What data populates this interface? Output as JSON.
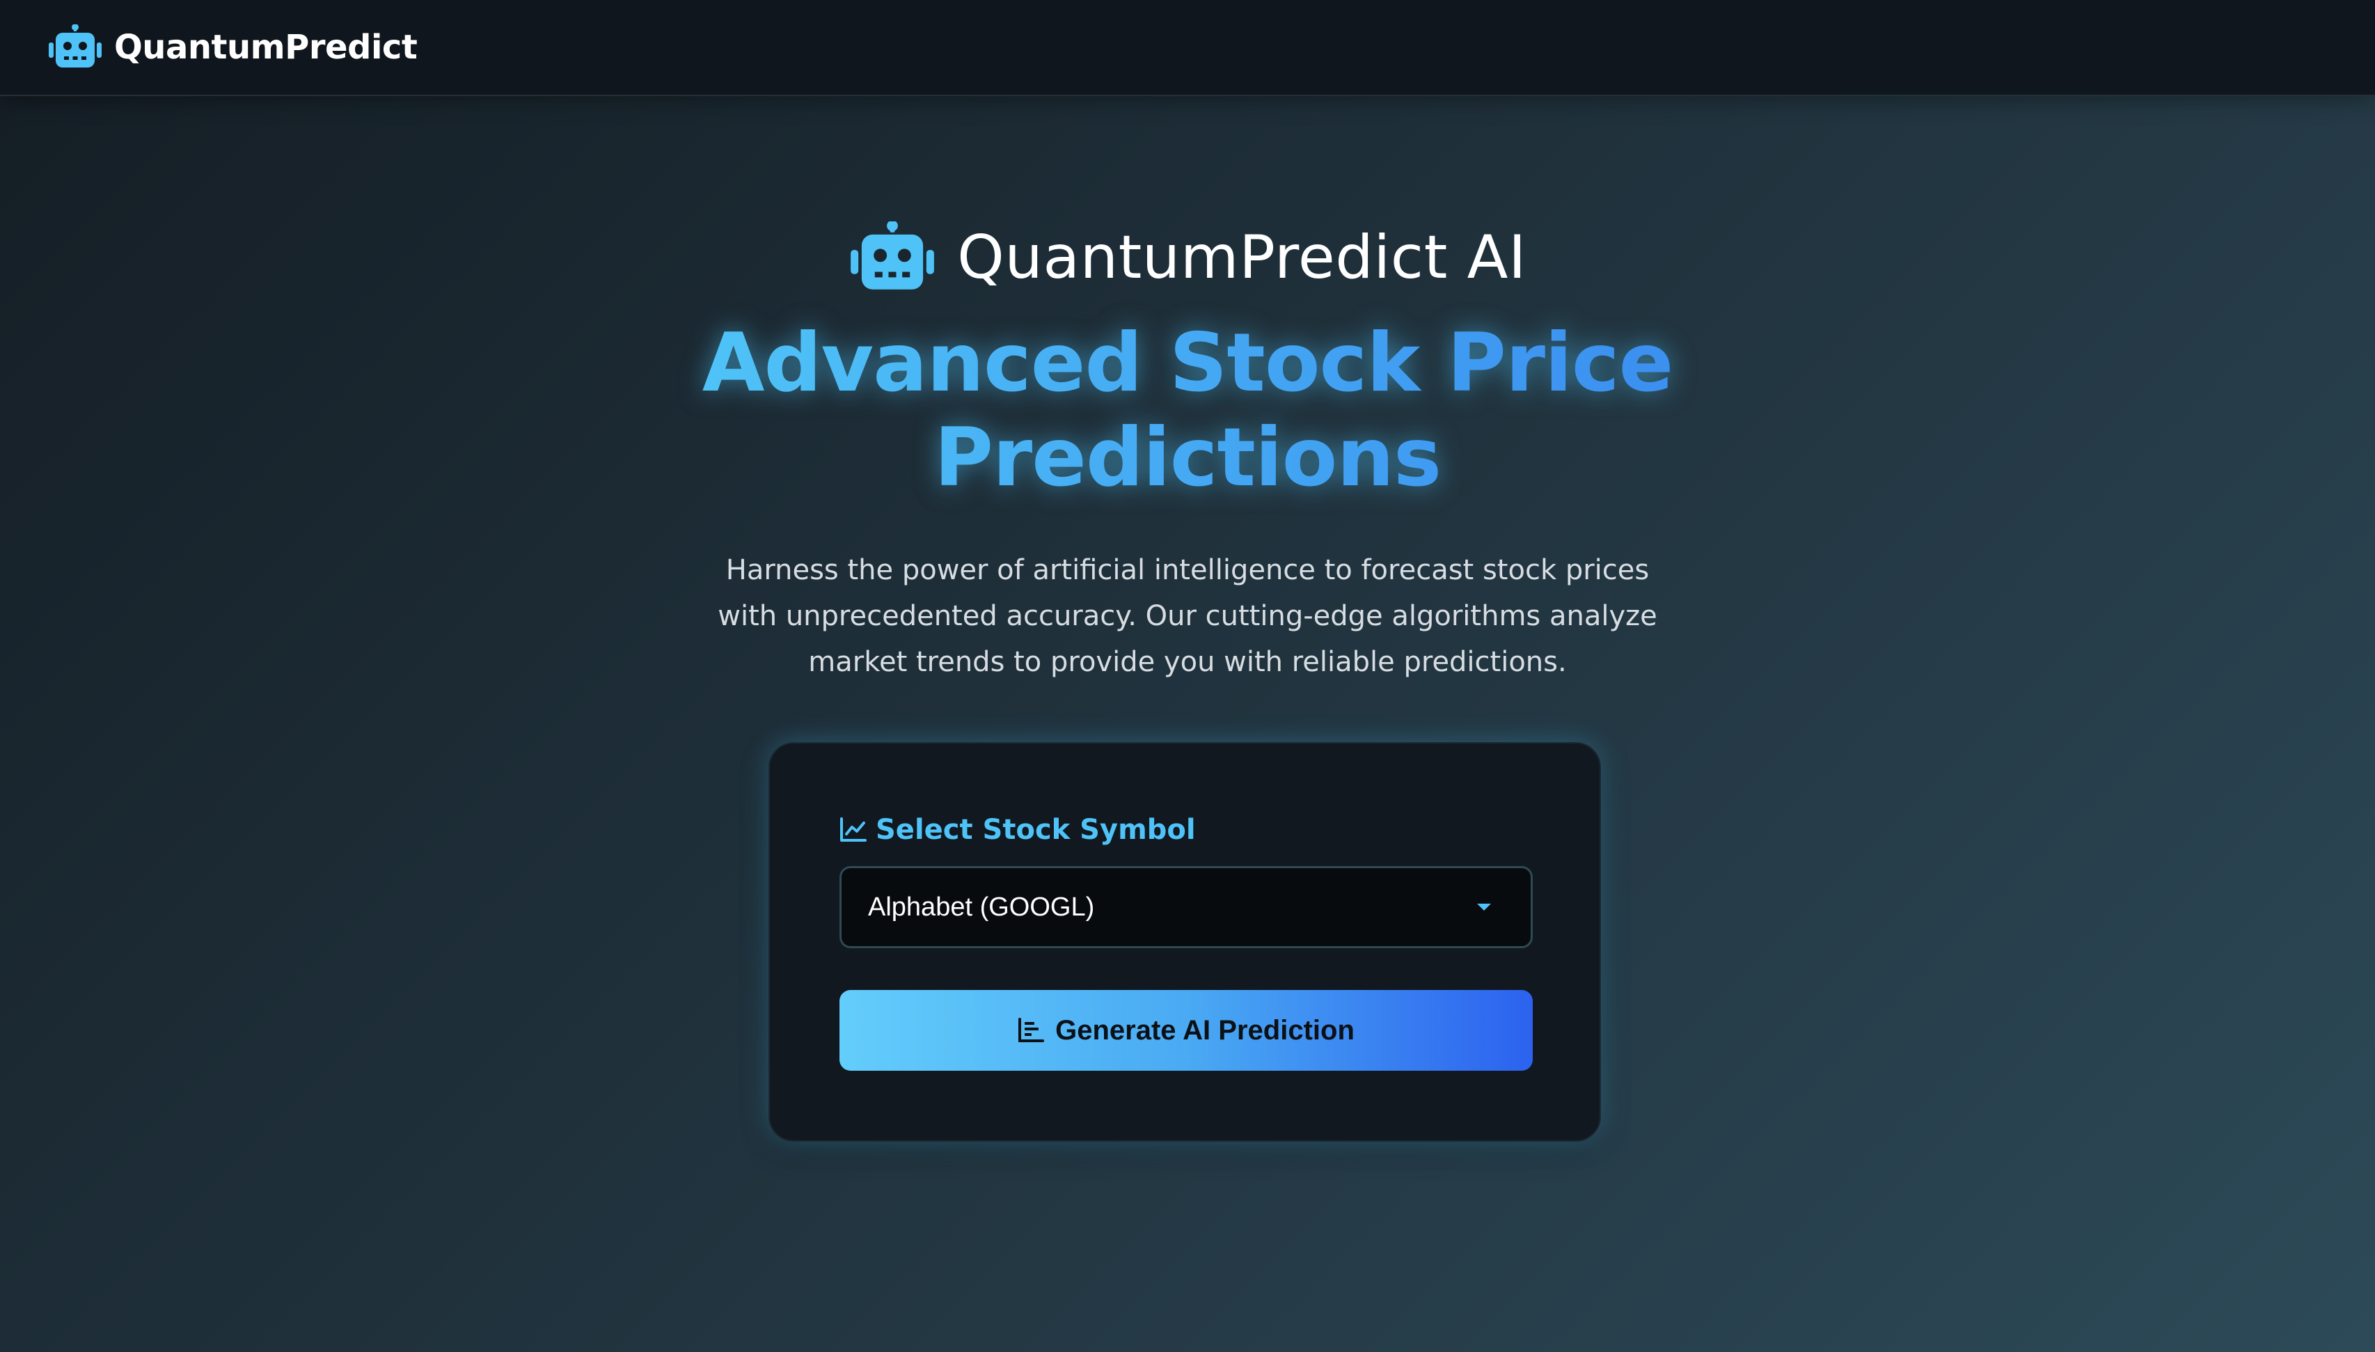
{
  "navbar": {
    "brand_icon": "robot-icon",
    "brand_name": "QuantumPredict"
  },
  "hero": {
    "icon": "robot-icon",
    "app_name": "QuantumPredict AI",
    "headline": "Advanced Stock Price Predictions",
    "description": "Harness the power of artificial intelligence to forecast stock prices with unprecedented accuracy. Our cutting-edge algorithms analyze market trends to provide you with reliable predictions."
  },
  "form": {
    "label_icon": "line-chart-icon",
    "label": "Select Stock Symbol",
    "selected_value": "Alphabet (GOOGL)",
    "dropdown_icon": "caret-down-icon",
    "button_icon": "bar-chart-icon",
    "button_label": "Generate AI Prediction"
  },
  "colors": {
    "accent": "#4fc3f7",
    "accent_dark": "#2c62ef",
    "navbar_bg": "#10161d",
    "card_bg": "#111820"
  }
}
